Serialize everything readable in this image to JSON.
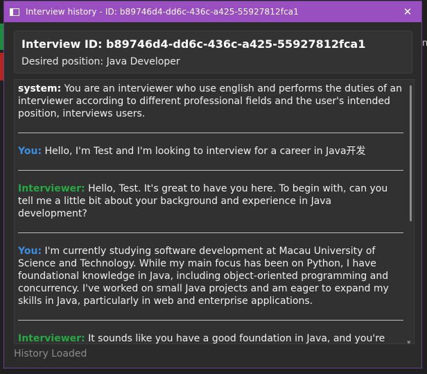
{
  "window": {
    "title": "Interview history - ID: b89746d4-dd6c-436c-a425-55927812fca1",
    "close_glyph": "✕"
  },
  "background": {
    "edge_text": "n"
  },
  "info": {
    "interview_id": "Interview ID: b89746d4-dd6c-436c-a425-55927812fca1",
    "desired_position": "Desired position: Java Developer"
  },
  "messages": [
    {
      "speaker": "system:",
      "role": "system",
      "text": " You are an interviewer who use english and performs the duties of an interviewer according to different professional fields and the user's intended position, interviews users."
    },
    {
      "speaker": "You:",
      "role": "you",
      "text": " Hello, I'm Test and I'm looking to interview for a career in Java开发"
    },
    {
      "speaker": "Interviewer:",
      "role": "interviewer",
      "text": " Hello, Test. It's great to have you here. To begin with, can you tell me a little bit about your background and experience in Java development?"
    },
    {
      "speaker": "You:",
      "role": "you",
      "text": " I'm currently studying software development at Macau University of Science and Technology. While my main focus has been on Python, I have foundational knowledge in Java, including object-oriented programming and concurrency. I've worked on small Java projects and am eager to expand my skills in Java, particularly in web and enterprise applications."
    },
    {
      "speaker": "Interviewer:",
      "role": "interviewer",
      "text": " It sounds like you have a good foundation in Java, and you're eager"
    }
  ],
  "status_text": "History Loaded",
  "colors": {
    "titlebar": "#9a4fc0",
    "you": "#3d8ee0",
    "interviewer": "#27a844"
  },
  "icons": {
    "app": "window-icon",
    "close": "close-icon"
  }
}
